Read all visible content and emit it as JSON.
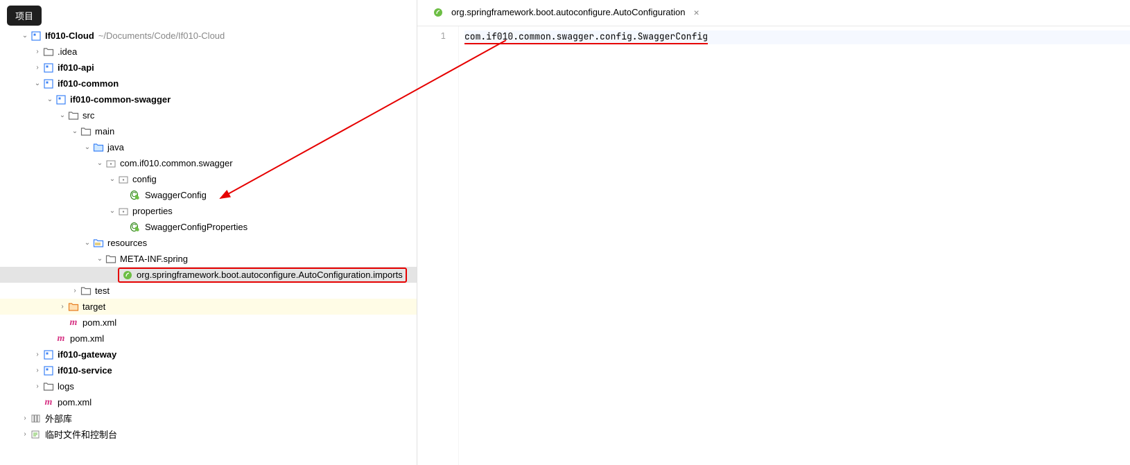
{
  "project_tab_label": "项目",
  "tree": {
    "root": {
      "name": "If010-Cloud",
      "path": "~/Documents/Code/If010-Cloud"
    },
    "idea": ".idea",
    "api": "if010-api",
    "common": "if010-common",
    "common_swagger": "if010-common-swagger",
    "src": "src",
    "main": "main",
    "java": "java",
    "pkg": "com.if010.common.swagger",
    "config": "config",
    "swagger_config": "SwaggerConfig",
    "properties": "properties",
    "swagger_config_props": "SwaggerConfigProperties",
    "resources": "resources",
    "meta_inf": "META-INF.spring",
    "autoconfig_file": "org.springframework.boot.autoconfigure.AutoConfiguration.imports",
    "test": "test",
    "target": "target",
    "pom_inner": "pom.xml",
    "pom_common": "pom.xml",
    "gateway": "if010-gateway",
    "service": "if010-service",
    "logs": "logs",
    "pom_root": "pom.xml",
    "ext_lib": "外部库",
    "scratch": "临时文件和控制台"
  },
  "tab": {
    "title": "org.springframework.boot.autoconfigure.AutoConfiguration"
  },
  "editor": {
    "line_number": "1",
    "line_content": "com.if010.common.swagger.config.SwaggerConfig"
  }
}
